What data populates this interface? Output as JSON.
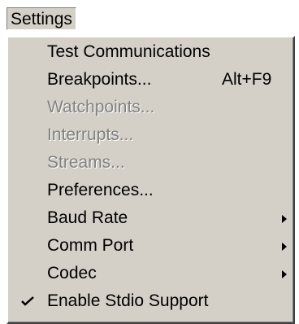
{
  "menubar": {
    "title": "Settings"
  },
  "menu": {
    "items": [
      {
        "label": "Test Communications"
      },
      {
        "label": "Breakpoints...",
        "shortcut": "Alt+F9"
      },
      {
        "label": "Watchpoints...",
        "disabled": true
      },
      {
        "label": "Interrupts...",
        "disabled": true
      },
      {
        "label": "Streams...",
        "disabled": true
      },
      {
        "label": "Preferences..."
      },
      {
        "label": "Baud Rate",
        "submenu": true
      },
      {
        "label": "Comm Port",
        "submenu": true
      },
      {
        "label": "Codec",
        "submenu": true
      },
      {
        "label": "Enable Stdio Support",
        "checked": true
      }
    ]
  },
  "icons": {
    "submenu": "chevron-right-icon",
    "checked": "check-icon"
  },
  "colors": {
    "menu_background": "#d4d0c8",
    "disabled_text": "#808080",
    "text": "#000000"
  }
}
